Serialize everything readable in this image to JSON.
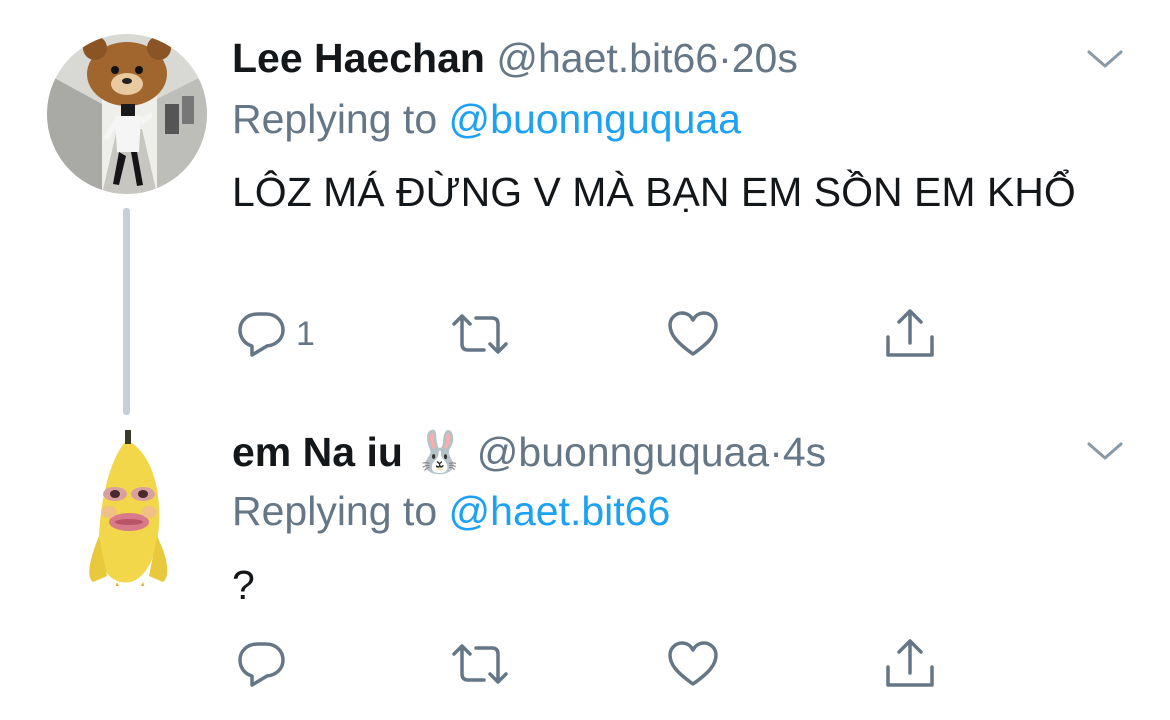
{
  "tweets": [
    {
      "display_name": "Lee Haechan",
      "handle": "@haet.bit66",
      "separator": "·",
      "time": "20s",
      "replying_prefix": "Replying to",
      "replying_to": "@buonnguquaa",
      "text": "LÔZ MÁ ĐỪNG V MÀ BẠN EM SỒN EM KHỔ",
      "reply_count": "1",
      "icons": [
        "reply-icon",
        "retweet-icon",
        "like-icon",
        "share-icon",
        "chevron-down-icon"
      ]
    },
    {
      "display_name": "em Na iu",
      "name_emoji": "🐰",
      "handle": "@buonnguquaa",
      "separator": "·",
      "time": "4s",
      "replying_prefix": "Replying to",
      "replying_to": "@haet.bit66",
      "text": "?",
      "reply_count": "",
      "icons": [
        "reply-icon",
        "retweet-icon",
        "like-icon",
        "share-icon",
        "chevron-down-icon"
      ]
    }
  ],
  "colors": {
    "text": "#14171a",
    "secondary": "#657786",
    "link": "#1da1f2",
    "thread_line": "#c4cfd6"
  }
}
